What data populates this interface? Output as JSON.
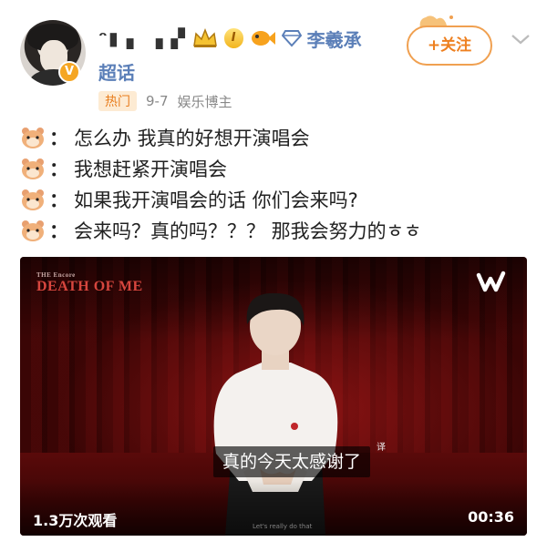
{
  "header": {
    "nickname": "ᵔ▮ ▖ ▗ ▞",
    "level": "I",
    "related_name": "李羲承",
    "chaohua": "超话",
    "follow_label": "+关注",
    "meta": {
      "tag": "热门",
      "date": "9-7",
      "source": "娱乐博主"
    },
    "colors": {
      "accent": "#ee8020",
      "link": "#5b7fb8",
      "tag_bg": "#fdebd3"
    }
  },
  "content": {
    "lines": [
      {
        "icon": "hamster-icon",
        "colon": "：",
        "text": "怎么办 我真的好想开演唱会"
      },
      {
        "icon": "hamster-icon",
        "colon": "：",
        "text": "我想赶紧开演唱会"
      },
      {
        "icon": "hamster-icon",
        "colon": "：",
        "text": "如果我开演唱会的话 你们会来吗?"
      },
      {
        "icon": "hamster-icon",
        "colon": "：",
        "text": "会来吗？真的吗？？？ 那我会努力的ㅎㅎ"
      }
    ]
  },
  "video": {
    "logo_small": "THE Encore",
    "logo_big": "DEATH OF ME",
    "platform_icon": "weverse-icon",
    "subtitle": "真的今天太感谢了",
    "translate_mark": "译",
    "small_subtitle": "Let's really do that",
    "views": "1.3万次观看",
    "duration": "00:36"
  }
}
